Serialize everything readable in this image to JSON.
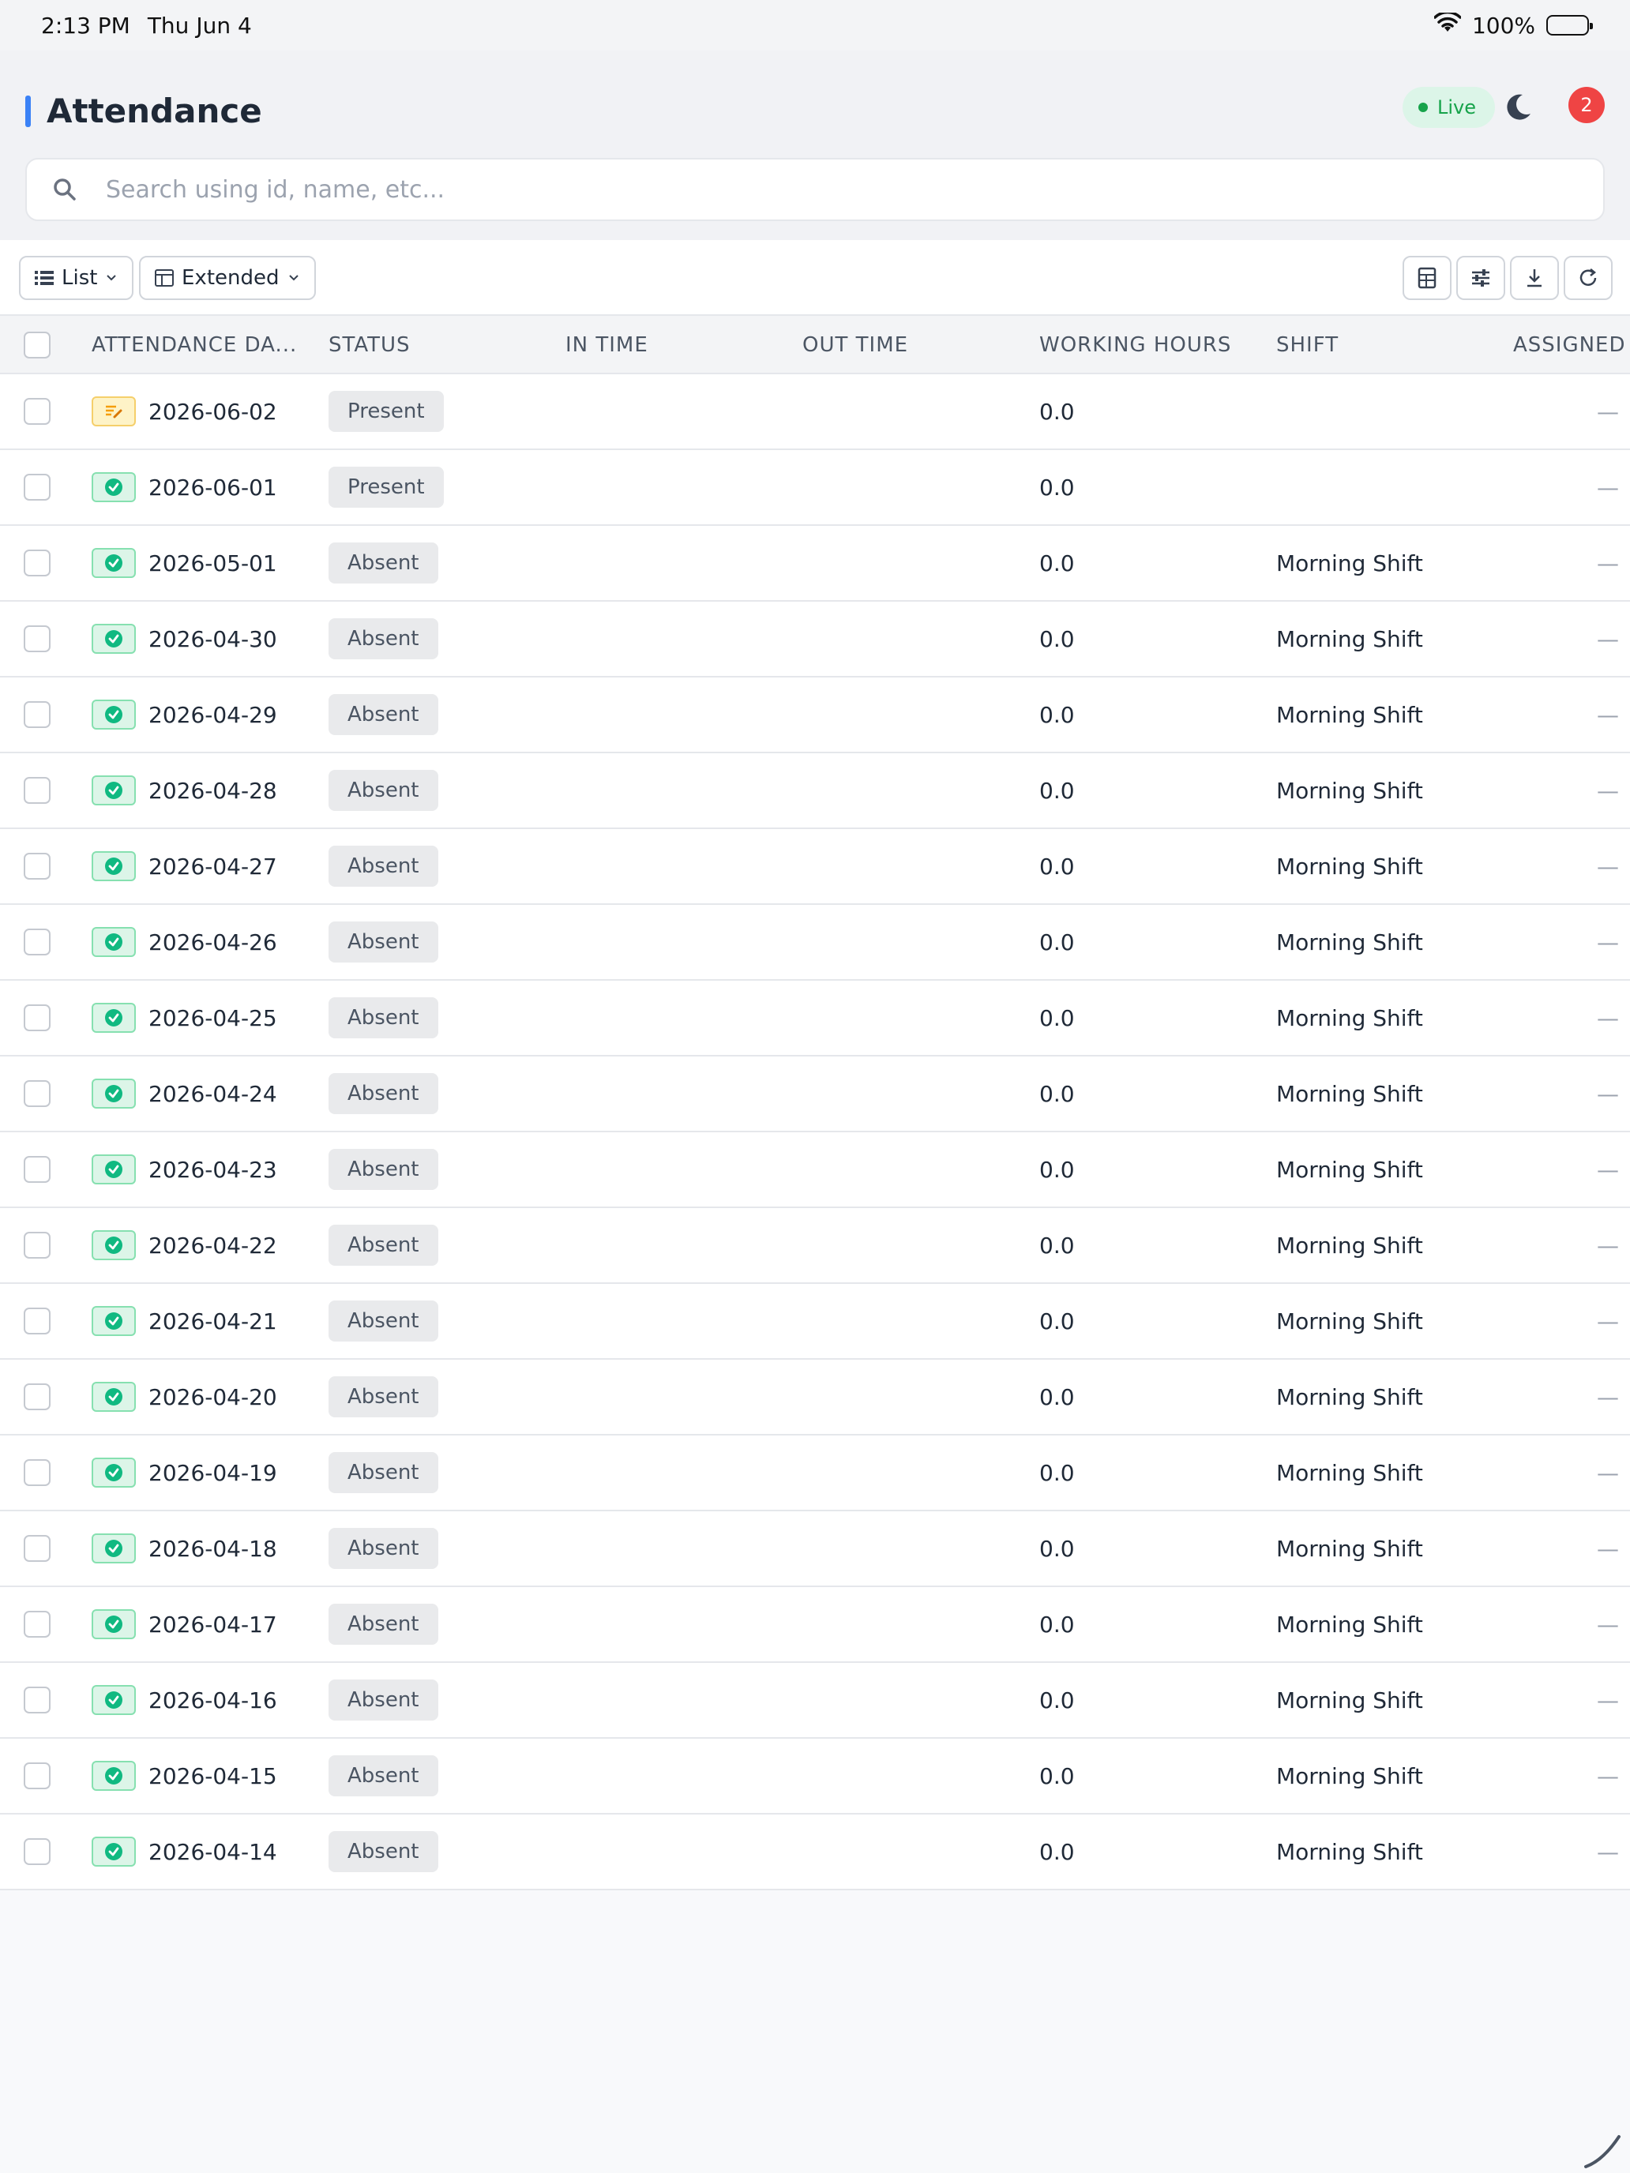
{
  "status_bar": {
    "time": "2:13 PM",
    "date": "Thu Jun 4",
    "battery": "100%"
  },
  "header": {
    "title": "Attendance",
    "live_label": "Live",
    "notification_count": "2"
  },
  "search": {
    "placeholder": "Search using id, name, etc..."
  },
  "toolbar": {
    "list_label": "List",
    "extended_label": "Extended"
  },
  "table": {
    "columns": [
      "ATTENDANCE DA...",
      "STATUS",
      "IN TIME",
      "OUT TIME",
      "WORKING HOURS",
      "SHIFT",
      "ASSIGNED"
    ],
    "rows": [
      {
        "date": "2026-06-02",
        "status": "Present",
        "in_time": "",
        "out_time": "",
        "hours": "0.0",
        "shift": "",
        "assigned": "—",
        "icon": "draft-icon"
      },
      {
        "date": "2026-06-01",
        "status": "Present",
        "in_time": "",
        "out_time": "",
        "hours": "0.0",
        "shift": "",
        "assigned": "—",
        "icon": "check-circle-icon"
      },
      {
        "date": "2026-05-01",
        "status": "Absent",
        "in_time": "",
        "out_time": "",
        "hours": "0.0",
        "shift": "Morning Shift",
        "assigned": "—",
        "icon": "check-circle-icon"
      },
      {
        "date": "2026-04-30",
        "status": "Absent",
        "in_time": "",
        "out_time": "",
        "hours": "0.0",
        "shift": "Morning Shift",
        "assigned": "—",
        "icon": "check-circle-icon"
      },
      {
        "date": "2026-04-29",
        "status": "Absent",
        "in_time": "",
        "out_time": "",
        "hours": "0.0",
        "shift": "Morning Shift",
        "assigned": "—",
        "icon": "check-circle-icon"
      },
      {
        "date": "2026-04-28",
        "status": "Absent",
        "in_time": "",
        "out_time": "",
        "hours": "0.0",
        "shift": "Morning Shift",
        "assigned": "—",
        "icon": "check-circle-icon"
      },
      {
        "date": "2026-04-27",
        "status": "Absent",
        "in_time": "",
        "out_time": "",
        "hours": "0.0",
        "shift": "Morning Shift",
        "assigned": "—",
        "icon": "check-circle-icon"
      },
      {
        "date": "2026-04-26",
        "status": "Absent",
        "in_time": "",
        "out_time": "",
        "hours": "0.0",
        "shift": "Morning Shift",
        "assigned": "—",
        "icon": "check-circle-icon"
      },
      {
        "date": "2026-04-25",
        "status": "Absent",
        "in_time": "",
        "out_time": "",
        "hours": "0.0",
        "shift": "Morning Shift",
        "assigned": "—",
        "icon": "check-circle-icon"
      },
      {
        "date": "2026-04-24",
        "status": "Absent",
        "in_time": "",
        "out_time": "",
        "hours": "0.0",
        "shift": "Morning Shift",
        "assigned": "—",
        "icon": "check-circle-icon"
      },
      {
        "date": "2026-04-23",
        "status": "Absent",
        "in_time": "",
        "out_time": "",
        "hours": "0.0",
        "shift": "Morning Shift",
        "assigned": "—",
        "icon": "check-circle-icon"
      },
      {
        "date": "2026-04-22",
        "status": "Absent",
        "in_time": "",
        "out_time": "",
        "hours": "0.0",
        "shift": "Morning Shift",
        "assigned": "—",
        "icon": "check-circle-icon"
      },
      {
        "date": "2026-04-21",
        "status": "Absent",
        "in_time": "",
        "out_time": "",
        "hours": "0.0",
        "shift": "Morning Shift",
        "assigned": "—",
        "icon": "check-circle-icon"
      },
      {
        "date": "2026-04-20",
        "status": "Absent",
        "in_time": "",
        "out_time": "",
        "hours": "0.0",
        "shift": "Morning Shift",
        "assigned": "—",
        "icon": "check-circle-icon"
      },
      {
        "date": "2026-04-19",
        "status": "Absent",
        "in_time": "",
        "out_time": "",
        "hours": "0.0",
        "shift": "Morning Shift",
        "assigned": "—",
        "icon": "check-circle-icon"
      },
      {
        "date": "2026-04-18",
        "status": "Absent",
        "in_time": "",
        "out_time": "",
        "hours": "0.0",
        "shift": "Morning Shift",
        "assigned": "—",
        "icon": "check-circle-icon"
      },
      {
        "date": "2026-04-17",
        "status": "Absent",
        "in_time": "",
        "out_time": "",
        "hours": "0.0",
        "shift": "Morning Shift",
        "assigned": "—",
        "icon": "check-circle-icon"
      },
      {
        "date": "2026-04-16",
        "status": "Absent",
        "in_time": "",
        "out_time": "",
        "hours": "0.0",
        "shift": "Morning Shift",
        "assigned": "—",
        "icon": "check-circle-icon"
      },
      {
        "date": "2026-04-15",
        "status": "Absent",
        "in_time": "",
        "out_time": "",
        "hours": "0.0",
        "shift": "Morning Shift",
        "assigned": "—",
        "icon": "check-circle-icon"
      },
      {
        "date": "2026-04-14",
        "status": "Absent",
        "in_time": "",
        "out_time": "",
        "hours": "0.0",
        "shift": "Morning Shift",
        "assigned": "—",
        "icon": "check-circle-icon"
      }
    ]
  },
  "colors": {
    "accent": "#3b82f6",
    "live": "#16a34a",
    "badge": "#ef4444",
    "check": "#10b981",
    "draft": "#f59e0b"
  }
}
